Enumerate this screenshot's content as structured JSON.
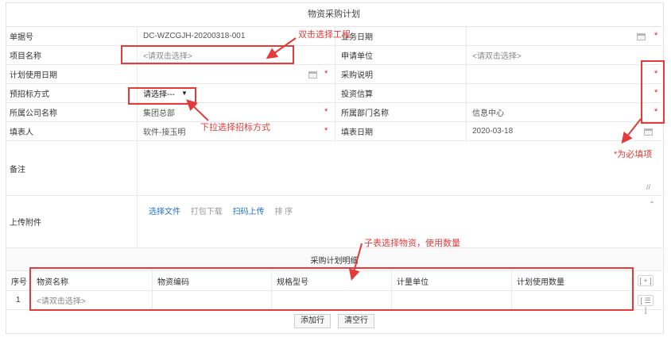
{
  "title": "物资采购计划",
  "rows": {
    "order_no": {
      "label": "单据号",
      "value": "DC-WZCGJH-20200318-001"
    },
    "business_date": {
      "label": "业务日期",
      "value": ""
    },
    "project_name": {
      "label": "项目名称",
      "placeholder": "<请双击选择>"
    },
    "apply_unit": {
      "label": "申请单位",
      "placeholder": "<请双击选择>"
    },
    "plan_date": {
      "label": "计划使用日期",
      "value": ""
    },
    "purchase_note": {
      "label": "采购说明",
      "value": ""
    },
    "bid_method": {
      "label": "预招标方式",
      "value": "请选择---"
    },
    "invest_estimate": {
      "label": "投资信算",
      "value": ""
    },
    "company": {
      "label": "所属公司名称",
      "value": "集团总部"
    },
    "department": {
      "label": "所属部门名称",
      "value": "信息中心"
    },
    "filler": {
      "label": "填表人",
      "value": "软件-接玉明"
    },
    "fill_date": {
      "label": "填表日期",
      "value": "2020-03-18"
    },
    "remark": {
      "label": "备注"
    },
    "attachment": {
      "label": "上传附件",
      "actions": [
        "选择文件",
        "打包下载",
        "扫码上传",
        "排 序"
      ]
    }
  },
  "required_mark": "*",
  "subtable": {
    "title": "采购计划明细",
    "columns": [
      "序号",
      "物资名称",
      "物资编码",
      "规格型号",
      "计量单位",
      "计划使用数量"
    ],
    "rows": [
      {
        "index": "1",
        "name_placeholder": "<请双击选择>"
      }
    ],
    "side_buttons": [
      "[ + ]",
      "[ ☰ ]"
    ],
    "add_row": "添加行",
    "clear_rows": "清空行"
  },
  "annotations": {
    "double_click": "双击选择工程",
    "dropdown": "下拉选择招标方式",
    "required": "*为必填项",
    "subtable": "子表选择物资，使用数量"
  },
  "colors": {
    "accent_red": "#e53a3a",
    "link_blue": "#1e6fd9"
  }
}
